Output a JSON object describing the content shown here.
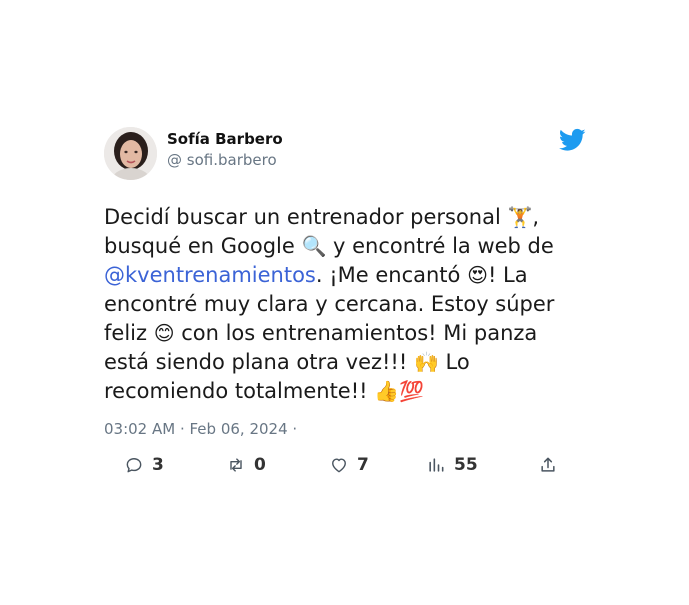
{
  "user": {
    "name": "Sofía Barbero",
    "handle": "@ sofi.barbero"
  },
  "tweet": {
    "segments": [
      {
        "text": "Decidí buscar un entrenador personal ",
        "type": "text"
      },
      {
        "text": "🏋",
        "type": "emoji"
      },
      {
        "text": ", busqué en Google ",
        "type": "text"
      },
      {
        "text": "🔍",
        "type": "emoji"
      },
      {
        "text": " y encontré la web de ",
        "type": "text"
      },
      {
        "text": "@kventrenamientos",
        "type": "mention"
      },
      {
        "text": ". ¡Me encantó ",
        "type": "text"
      },
      {
        "text": "😍",
        "type": "emoji"
      },
      {
        "text": "! La encontré muy clara y cercana. Estoy súper feliz ",
        "type": "text"
      },
      {
        "text": "😊",
        "type": "emoji"
      },
      {
        "text": " con los entrenamientos! Mi panza está siendo plana otra vez!!! ",
        "type": "text"
      },
      {
        "text": "🙌",
        "type": "emoji"
      },
      {
        "text": " Lo recomiendo totalmente!! ",
        "type": "text"
      },
      {
        "text": "👍",
        "type": "emoji"
      },
      {
        "text": "💯",
        "type": "emoji"
      }
    ]
  },
  "meta": {
    "text": "03:02 AM · Feb 06, 2024 ·"
  },
  "actions": {
    "reply_count": "3",
    "retweet_count": "0",
    "like_count": "7",
    "views_count": "55"
  },
  "colors": {
    "twitter_blue": "#1d9bf0",
    "mention": "#3b63d6",
    "muted": "#687684"
  },
  "icons": {
    "brand": "twitter-bird-icon",
    "reply": "comment-icon",
    "retweet": "retweet-icon",
    "like": "heart-icon",
    "views": "bar-chart-icon",
    "share": "share-icon"
  }
}
